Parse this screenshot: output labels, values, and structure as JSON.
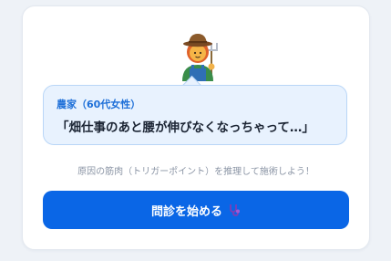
{
  "patient": {
    "speaker": "農家（60代女性）",
    "quote": "「畑仕事のあと腰が伸びなくなっちゃって…」"
  },
  "hint": "原因の筋肉（トリガーポイント）を推理して施術しよう！",
  "start_button": {
    "label": "問診を始める",
    "icon": "stethoscope-icon"
  },
  "colors": {
    "accent": "#0a66e6",
    "bubble_bg": "#e8f2fe",
    "speaker": "#1d6fd8"
  }
}
